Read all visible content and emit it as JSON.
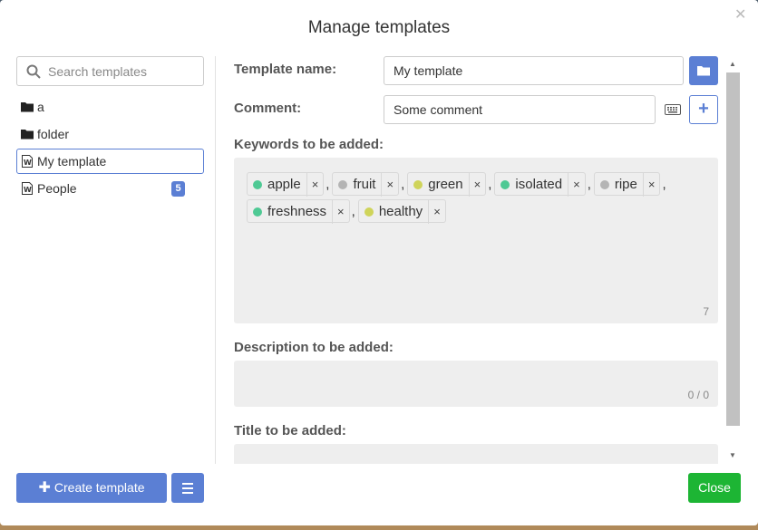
{
  "dialog": {
    "title": "Manage templates"
  },
  "search": {
    "placeholder": "Search templates",
    "value": ""
  },
  "tree": {
    "items": [
      {
        "label": "a",
        "icon": "folder-icon"
      },
      {
        "label": "folder",
        "icon": "folder-icon"
      },
      {
        "label": "My template",
        "icon": "word-document-icon",
        "selected": true
      },
      {
        "label": "People",
        "icon": "word-document-icon",
        "badge": "5"
      }
    ]
  },
  "form": {
    "template_name_label": "Template name:",
    "template_name_value": "My template",
    "comment_label": "Comment:",
    "comment_value": "Some comment",
    "keywords_label": "Keywords to be added:",
    "keywords_count": "7",
    "keywords": [
      {
        "text": "apple",
        "color": "#4ec994"
      },
      {
        "text": "fruit",
        "color": "#b4b4b4"
      },
      {
        "text": "green",
        "color": "#cfd45a"
      },
      {
        "text": "isolated",
        "color": "#4ec994"
      },
      {
        "text": "ripe",
        "color": "#b4b4b4"
      },
      {
        "text": "freshness",
        "color": "#4ec994"
      },
      {
        "text": "healthy",
        "color": "#cfd45a"
      }
    ],
    "description_label": "Description to be added:",
    "description_counter": "0 / 0",
    "title_label": "Title to be added:"
  },
  "footer": {
    "create_label": "Create template",
    "close_label": "Close"
  },
  "colors": {
    "accent": "#5b7fd4",
    "close": "#1db534"
  }
}
